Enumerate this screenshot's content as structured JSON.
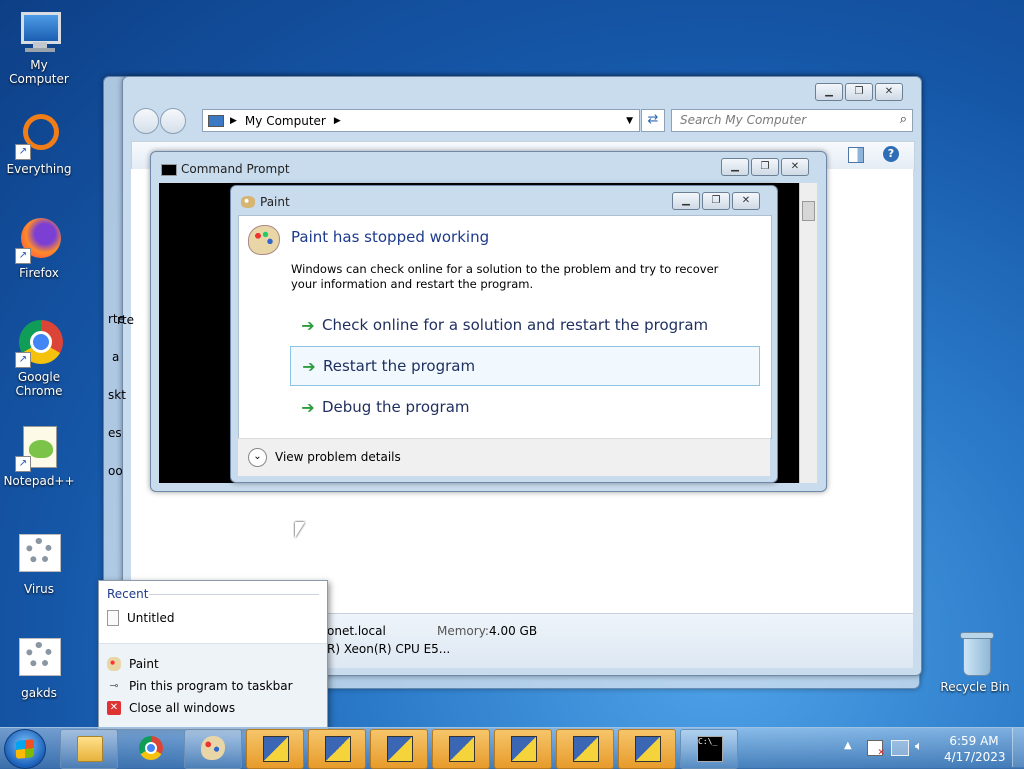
{
  "desktop": {
    "icons": [
      {
        "label": "My Computer"
      },
      {
        "label": "Everything"
      },
      {
        "label": "Firefox"
      },
      {
        "label": "Google Chrome"
      },
      {
        "label": "Notepad++"
      },
      {
        "label": "Virus"
      },
      {
        "label": "gakds"
      },
      {
        "label": "Recycle Bin"
      }
    ]
  },
  "explorer": {
    "address": "My Computer",
    "search_placeholder": "Search My Computer",
    "computer_name_fragment": "onet.local",
    "memory_label": "Memory:",
    "memory_value": "4.00 GB",
    "processor_fragment": "R) Xeon(R) CPU E5...",
    "left_fragments": [
      "rte",
      "a",
      "skt",
      "es",
      "oo"
    ]
  },
  "cmd": {
    "title": "Command Prompt"
  },
  "dialog": {
    "title": "Paint",
    "heading": "Paint has stopped working",
    "body": "Windows can check online for a solution to the problem and try to recover your information and restart the program.",
    "options": [
      "Check online for a solution and restart the program",
      "Restart the program",
      "Debug the program"
    ],
    "details": "View problem details"
  },
  "jumplist": {
    "recent_header": "Recent",
    "recent_items": [
      "Untitled"
    ],
    "tasks": [
      "Paint",
      "Pin this program to taskbar",
      "Close all windows"
    ]
  },
  "taskbar": {
    "time": "6:59 AM",
    "date": "4/17/2023"
  },
  "colors": {
    "dialog_heading": "#1e3a8c",
    "taskbar_open": "#e79b2b",
    "arrow_green": "#2c9c3c"
  }
}
